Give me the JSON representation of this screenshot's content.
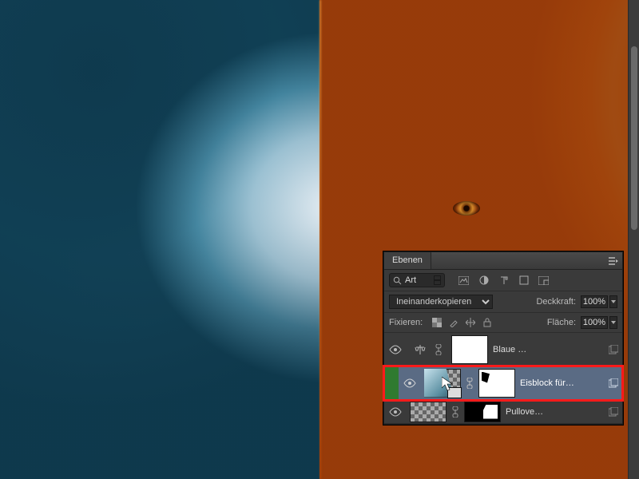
{
  "panel": {
    "title": "Ebenen",
    "search_label": "Art",
    "blend_mode": "Ineinanderkopieren",
    "opacity_label": "Deckkraft:",
    "opacity_value": "100%",
    "lock_label": "Fixieren:",
    "fill_label": "Fläche:",
    "fill_value": "100%"
  },
  "layers": [
    {
      "name": "Blaue …",
      "selected": false,
      "type": "adjustment"
    },
    {
      "name": "Eisblock für…",
      "selected": true,
      "type": "smart"
    },
    {
      "name": "Pullove…",
      "selected": false,
      "type": "bitmap"
    }
  ]
}
